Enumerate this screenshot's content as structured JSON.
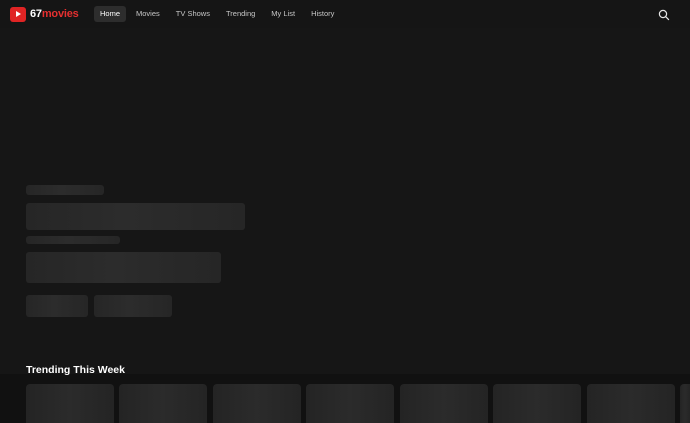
{
  "brand": {
    "number": "67",
    "word": "movies"
  },
  "nav": [
    {
      "label": "Home",
      "active": true
    },
    {
      "label": "Movies",
      "active": false
    },
    {
      "label": "TV Shows",
      "active": false
    },
    {
      "label": "Trending",
      "active": false
    },
    {
      "label": "My List",
      "active": false
    },
    {
      "label": "History",
      "active": false
    }
  ],
  "icons": {
    "logo": "play-icon",
    "search": "search-icon"
  },
  "colors": {
    "brand_red": "#e02424",
    "background": "#161616"
  },
  "sections": [
    {
      "title": "Trending This Week"
    }
  ]
}
